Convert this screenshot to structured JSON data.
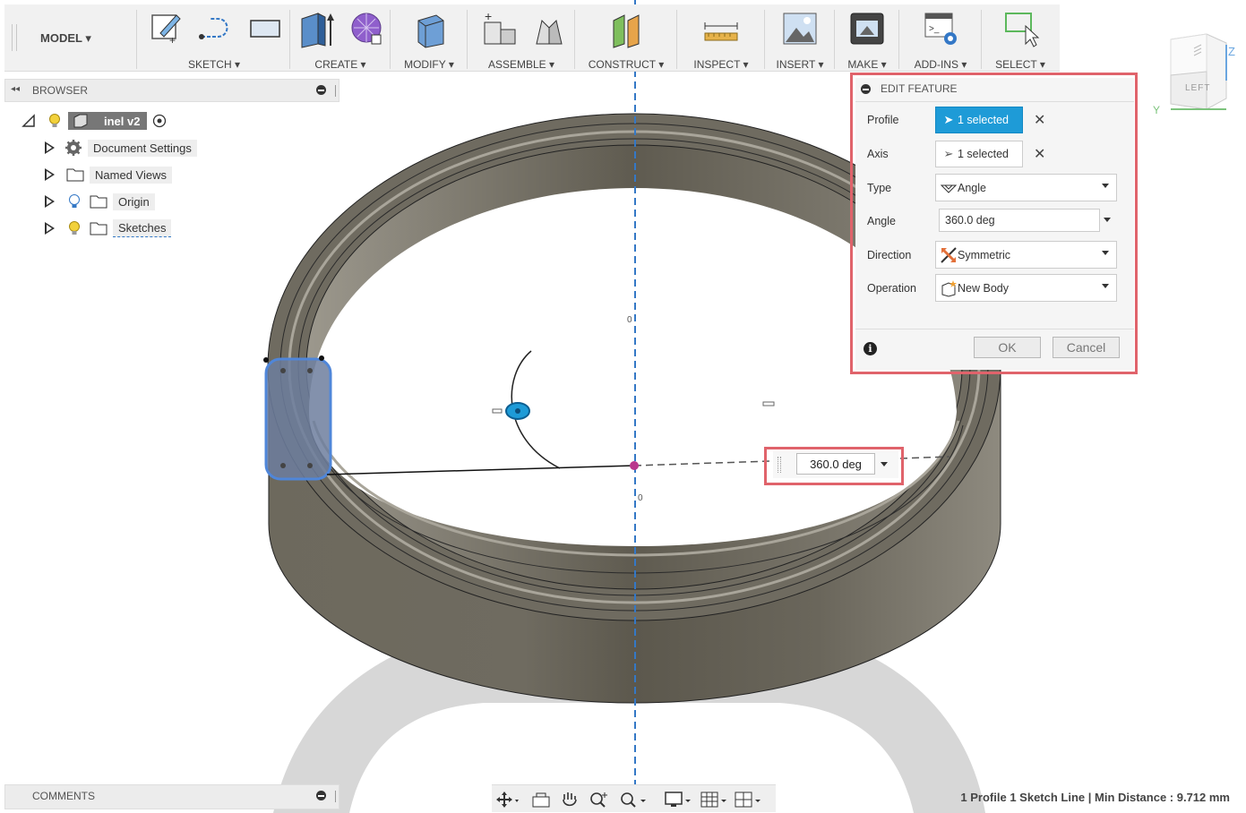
{
  "toolbar": {
    "workspace": "MODEL",
    "groups": {
      "sketch": "SKETCH",
      "create": "CREATE",
      "modify": "MODIFY",
      "assemble": "ASSEMBLE",
      "construct": "CONSTRUCT",
      "inspect": "INSPECT",
      "insert": "INSERT",
      "make": "MAKE",
      "addins": "ADD-INS",
      "select": "SELECT"
    }
  },
  "browser": {
    "title": "BROWSER",
    "root": "inel v2",
    "items": [
      {
        "label": "Document Settings",
        "icon": "gear-icon"
      },
      {
        "label": "Named Views",
        "icon": "folder-icon"
      },
      {
        "label": "Origin",
        "icon": "folder-icon"
      },
      {
        "label": "Sketches",
        "icon": "folder-icon"
      }
    ]
  },
  "comments": {
    "title": "COMMENTS"
  },
  "edit_feature": {
    "title": "EDIT FEATURE",
    "profile": {
      "label": "Profile",
      "value": "1 selected"
    },
    "axis": {
      "label": "Axis",
      "value": "1 selected"
    },
    "type": {
      "label": "Type",
      "value": "Angle"
    },
    "angle": {
      "label": "Angle",
      "value": "360.0 deg"
    },
    "direction": {
      "label": "Direction",
      "value": "Symmetric"
    },
    "operation": {
      "label": "Operation",
      "value": "New Body"
    },
    "ok": "OK",
    "cancel": "Cancel"
  },
  "dimension": {
    "value": "360.0 deg"
  },
  "viewcube": {
    "face": "LEFT",
    "axis_y": "Y",
    "axis_z": "Z"
  },
  "status": "1 Profile 1 Sketch Line | Min Distance : 9.712 mm",
  "colors": {
    "accent": "#1e9bd7",
    "highlight": "#e0636b",
    "model": "#6f6a5e"
  }
}
